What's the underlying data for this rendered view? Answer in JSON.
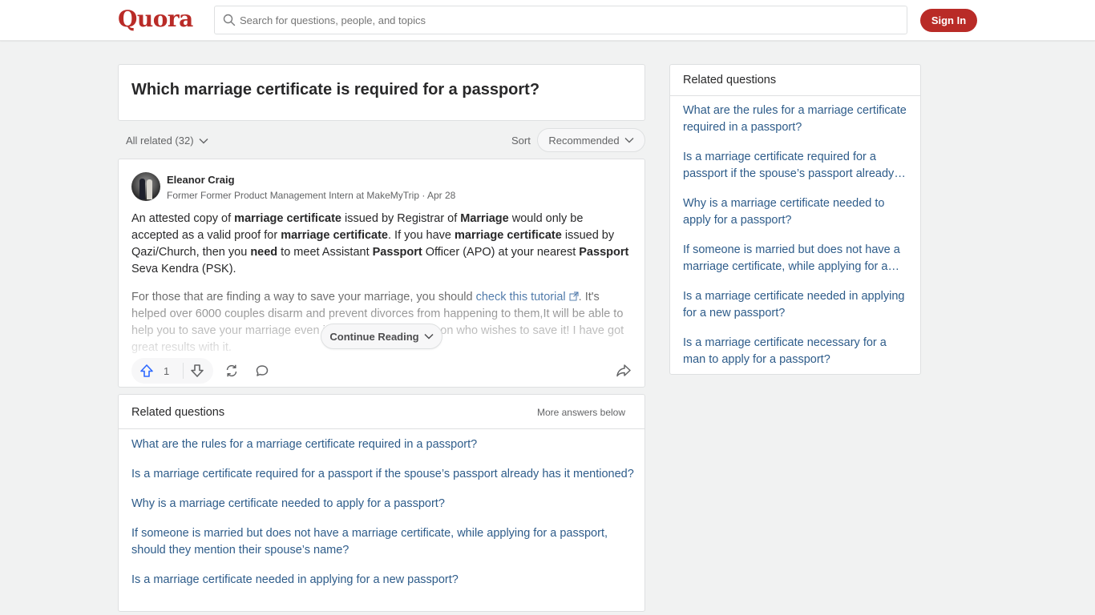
{
  "header": {
    "logo": "Quora",
    "search_placeholder": "Search for questions, people, and topics",
    "signin_label": "Sign In",
    "brand_color": "#b92b27"
  },
  "question": {
    "title": "Which marriage certificate is required for a passport?"
  },
  "filters": {
    "all_related": "All related (32)",
    "sort_label": "Sort",
    "sort_value": "Recommended"
  },
  "answer": {
    "author_name": "Eleanor Craig",
    "author_credential": "Former Former Product Management Intern at MakeMyTrip · Apr 28",
    "paragraph1": [
      {
        "t": "An attested copy of ",
        "b": false
      },
      {
        "t": "marriage certificate",
        "b": true
      },
      {
        "t": " issued by Registrar of ",
        "b": false
      },
      {
        "t": "Marriage",
        "b": true
      },
      {
        "t": " would only be accepted as a valid proof for ",
        "b": false
      },
      {
        "t": "marriage certificate",
        "b": true
      },
      {
        "t": ". If you have ",
        "b": false
      },
      {
        "t": "marriage certificate",
        "b": true
      },
      {
        "t": " issued by Qazi/Church, then you ",
        "b": false
      },
      {
        "t": "need",
        "b": true
      },
      {
        "t": " to meet Assistant ",
        "b": false
      },
      {
        "t": "Passport",
        "b": true
      },
      {
        "t": " Officer (APO) at your nearest ",
        "b": false
      },
      {
        "t": "Passport",
        "b": true
      },
      {
        "t": " Seva Kendra (PSK).",
        "b": false
      }
    ],
    "paragraph2_before": "For those that are finding a way to save your marriage, you should ",
    "paragraph2_link": "check this tutorial",
    "paragraph2_after": ". It's helped over 6000 couples disarm and prevent divorces from happening to them,It will be able to help you to save your marriage even if you are the only person who wishes to save it! I have got great results with it.",
    "continue_label": "Continue Reading",
    "upvotes": "1",
    "upvote_color": "#2e69ff"
  },
  "related_main": {
    "title": "Related questions",
    "more_below": "More answers below",
    "items": [
      "What are the rules for a marriage certificate required in a passport?",
      "Is a marriage certificate required for a passport if the spouse’s passport already has it mentioned?",
      "Why is a marriage certificate needed to apply for a passport?",
      "If someone is married but does not have a marriage certificate, while applying for a passport, should they mention their spouse’s name?",
      "Is a marriage certificate needed in applying for a new passport?"
    ]
  },
  "related_side": {
    "title": "Related questions",
    "items": [
      "What are the rules for a marriage certificate required in a passport?",
      "Is a marriage certificate required for a passport if the spouse’s passport already has it mentioned?",
      "Why is a marriage certificate needed to apply for a passport?",
      "If someone is married but does not have a marriage certificate, while applying for a passport, should they mention their spouse’s name?",
      "Is a marriage certificate needed in applying for a new passport?",
      "Is a marriage certificate necessary for a man to apply for a passport?"
    ]
  }
}
